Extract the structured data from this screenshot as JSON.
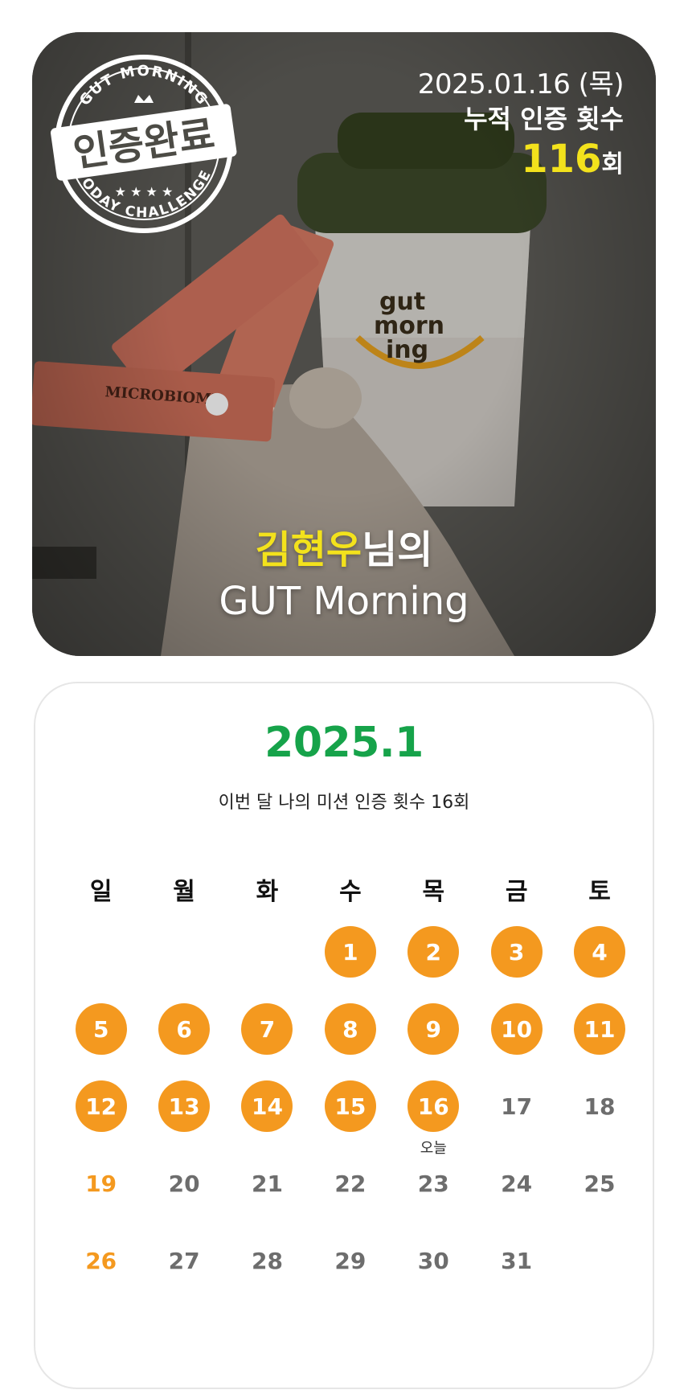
{
  "hero": {
    "date": "2025.01.16 (목)",
    "count_label": "누적 인증 횟수",
    "count_value": "116",
    "count_unit": "회",
    "user_name": "김현우",
    "user_suffix": "님의",
    "brand": "GUT Morning",
    "stamp": {
      "top_text": "GUT MORNING",
      "center_text": "인증완료",
      "bottom_text": "TODAY CHALLENGE"
    }
  },
  "calendar": {
    "title": "2025.1",
    "subtitle": "이번 달 나의 미션 인증 횟수 16회",
    "weekdays": [
      "일",
      "월",
      "화",
      "수",
      "목",
      "금",
      "토"
    ],
    "leading_blank_days": 3,
    "days_in_month": 31,
    "completed_through": 16,
    "today": 16,
    "today_label": "오늘",
    "colors": {
      "accent": "#f4991f",
      "title": "#16a34a",
      "highlight": "#f3e21c"
    }
  }
}
